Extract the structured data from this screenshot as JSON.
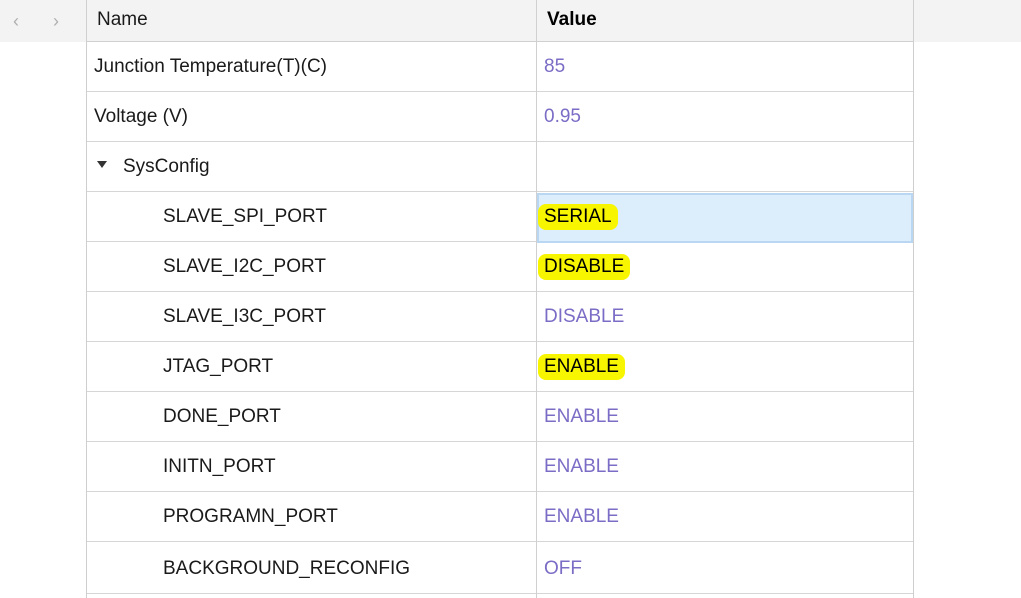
{
  "nav": {
    "back_icon": "‹",
    "forward_icon": "›"
  },
  "columns": {
    "name": "Name",
    "value": "Value"
  },
  "rows": [
    {
      "name": "Junction Temperature(T)(C)",
      "value": "85"
    },
    {
      "name": "Voltage (V)",
      "value": "0.95"
    }
  ],
  "group": {
    "name": "SysConfig",
    "items": [
      {
        "name": "SLAVE_SPI_PORT",
        "value": "SERIAL"
      },
      {
        "name": "SLAVE_I2C_PORT",
        "value": "DISABLE"
      },
      {
        "name": "SLAVE_I3C_PORT",
        "value": "DISABLE"
      },
      {
        "name": "JTAG_PORT",
        "value": "ENABLE"
      },
      {
        "name": "DONE_PORT",
        "value": "ENABLE"
      },
      {
        "name": "INITN_PORT",
        "value": "ENABLE"
      },
      {
        "name": "PROGRAMN_PORT",
        "value": "ENABLE"
      },
      {
        "name": "BACKGROUND_RECONFIG",
        "value": "OFF"
      }
    ]
  },
  "colors": {
    "value_text": "#7b6cc6",
    "highlight": "#f7f500",
    "selection": "#dcedfb"
  }
}
